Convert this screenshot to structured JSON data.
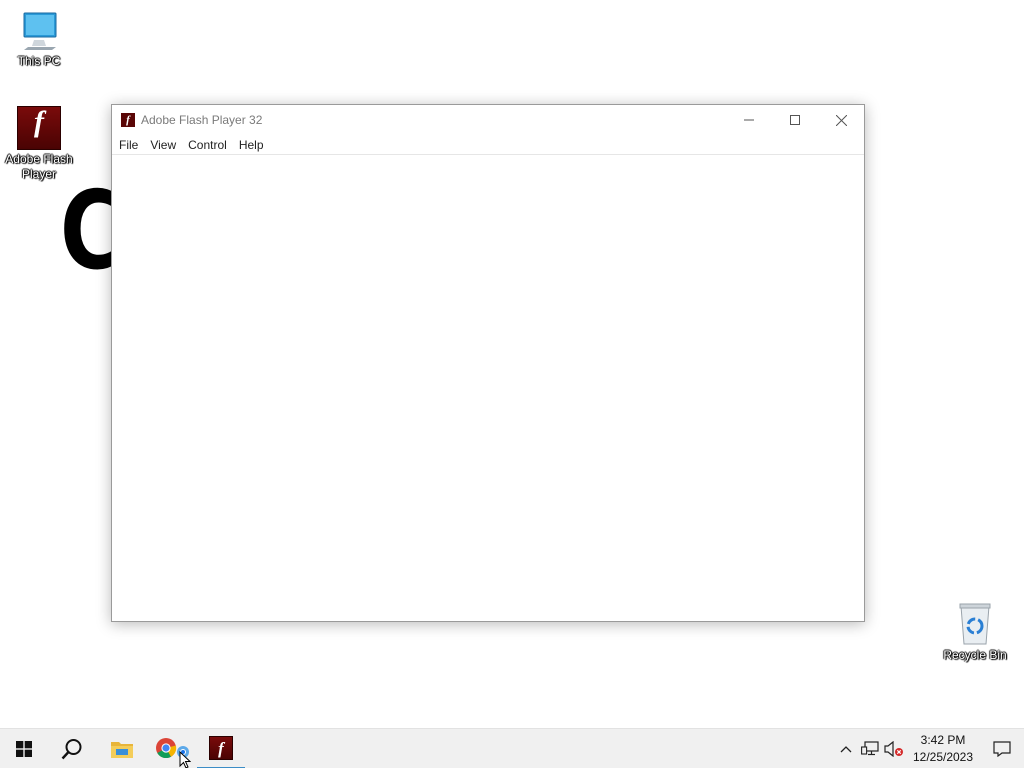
{
  "desktop": {
    "icons": [
      {
        "label": "This PC",
        "icon": "computer-icon"
      },
      {
        "label": "Adobe Flash Player",
        "icon": "flash-player-icon"
      },
      {
        "label": "Recycle Bin",
        "icon": "recycle-bin-icon"
      }
    ],
    "background_glyph": "C"
  },
  "window": {
    "title": "Adobe Flash Player 32",
    "icon": "flash-player-icon",
    "controls": {
      "minimize": "minimize-icon",
      "maximize": "maximize-icon",
      "close": "close-icon"
    },
    "menu": [
      "File",
      "View",
      "Control",
      "Help"
    ]
  },
  "taskbar": {
    "pinned": [
      {
        "name": "start",
        "icon": "windows-logo-icon"
      },
      {
        "name": "search",
        "icon": "search-icon"
      },
      {
        "name": "file-explorer",
        "icon": "folder-icon"
      },
      {
        "name": "chrome",
        "icon": "chrome-icon"
      },
      {
        "name": "flash-player",
        "icon": "flash-player-icon",
        "active": true
      }
    ],
    "tray": {
      "icons": [
        "chevron-up-icon",
        "network-icon",
        "volume-muted-icon"
      ],
      "time": "3:42 PM",
      "date": "12/25/2023"
    },
    "notification_icon": "notification-icon"
  },
  "colors": {
    "flash_red": "#5a0606",
    "taskbar_bg": "#f0f0f0",
    "active_indicator": "#3c8dc6",
    "folder_yellow": "#e8b53a"
  }
}
